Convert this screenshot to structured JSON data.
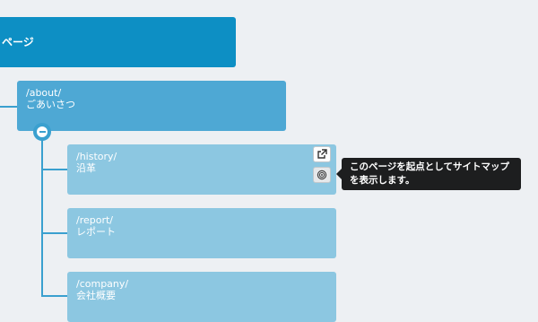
{
  "tree": {
    "root": {
      "label": "ページ"
    },
    "about": {
      "path": "/about/",
      "name": "ごあいさつ"
    },
    "children": [
      {
        "path": "/history/",
        "name": "沿革"
      },
      {
        "path": "/report/",
        "name": "レポート"
      },
      {
        "path": "/company/",
        "name": "会社概要"
      }
    ]
  },
  "tooltip": {
    "text": "このページを起点としてサイトマップを表示します。"
  },
  "icons": {
    "open": "external-link-icon",
    "target": "target-icon",
    "collapse": "minus-icon"
  },
  "colors": {
    "root": "#0d8fc4",
    "level1": "#4ea8d4",
    "level2": "#8cc7e1",
    "connector": "#3aa0cf",
    "background": "#edf0f3",
    "tooltip": "#1d1e1f"
  }
}
